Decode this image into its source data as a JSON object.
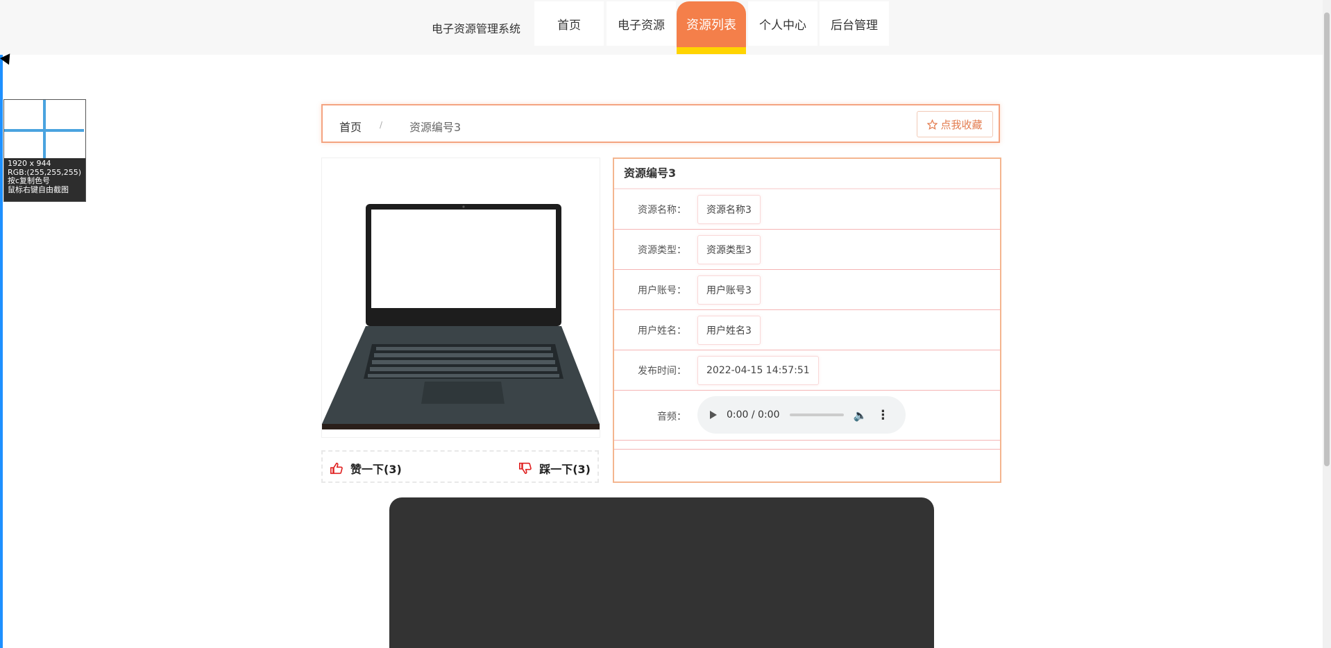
{
  "header": {
    "site_title": "电子资源管理系统",
    "nav": [
      {
        "label": "首页"
      },
      {
        "label": "电子资源"
      },
      {
        "label": "资源列表"
      },
      {
        "label": "个人中心"
      },
      {
        "label": "后台管理"
      }
    ],
    "active_index": 2
  },
  "picker": {
    "size": "1920 x 944",
    "rgb": "RGB:(255,255,255)",
    "hint1": "按c复制色号",
    "hint2": "鼠标右键自由截图"
  },
  "breadcrumb": {
    "home": "首页",
    "separator": "/",
    "current": "资源编号3"
  },
  "favorite_button": {
    "icon": "star-icon",
    "label": "点我收藏"
  },
  "votes": {
    "like_label": "赞一下(3)",
    "dislike_label": "踩一下(3)"
  },
  "detail": {
    "title": "资源编号3",
    "fields": [
      {
        "label": "资源名称：",
        "value": "资源名称3"
      },
      {
        "label": "资源类型：",
        "value": "资源类型3"
      },
      {
        "label": "用户账号：",
        "value": "用户账号3"
      },
      {
        "label": "用户姓名：",
        "value": "用户姓名3"
      },
      {
        "label": "发布时间：",
        "value": "2022-04-15 14:57:51"
      }
    ],
    "audio_label": "音频：",
    "audio_time": "0:00 / 0:00"
  },
  "colors": {
    "accent": "#f47f4a",
    "active_underline": "#ffd400"
  }
}
